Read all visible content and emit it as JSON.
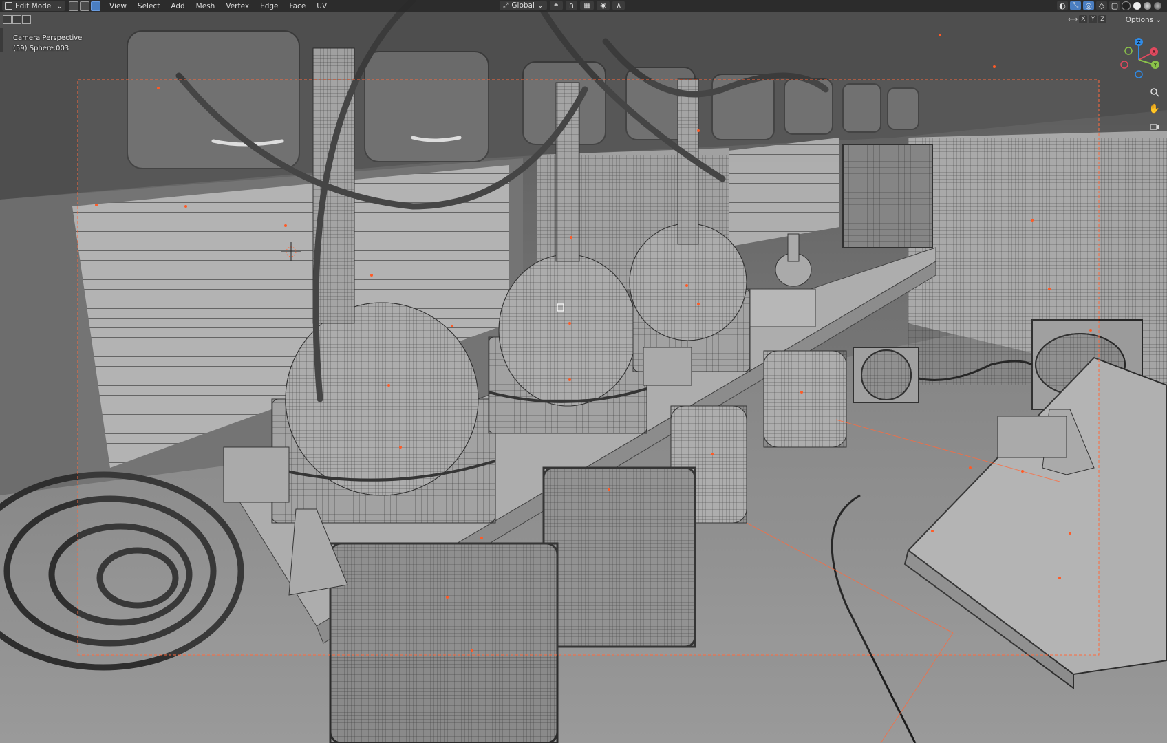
{
  "header": {
    "mode": "Edit Mode",
    "menus": [
      "View",
      "Select",
      "Add",
      "Mesh",
      "Vertex",
      "Edge",
      "Face",
      "UV"
    ],
    "transform_orientation": "Global"
  },
  "toolbar2": {
    "axes": [
      "X",
      "Y",
      "Z"
    ],
    "options_label": "Options"
  },
  "viewport": {
    "view_name": "Camera Perspective",
    "active_object": "(59) Sphere.003"
  },
  "gizmo": {
    "x": "X",
    "y": "Y",
    "z": "Z"
  },
  "colors": {
    "accent": "#4a7ec1",
    "selection": "#ff6a3d",
    "x_axis": "#e0495e",
    "y_axis": "#8bc34a",
    "z_axis": "#2f8be6"
  },
  "icons": [
    "zoom-icon",
    "hand-pan-icon",
    "camera-icon"
  ]
}
